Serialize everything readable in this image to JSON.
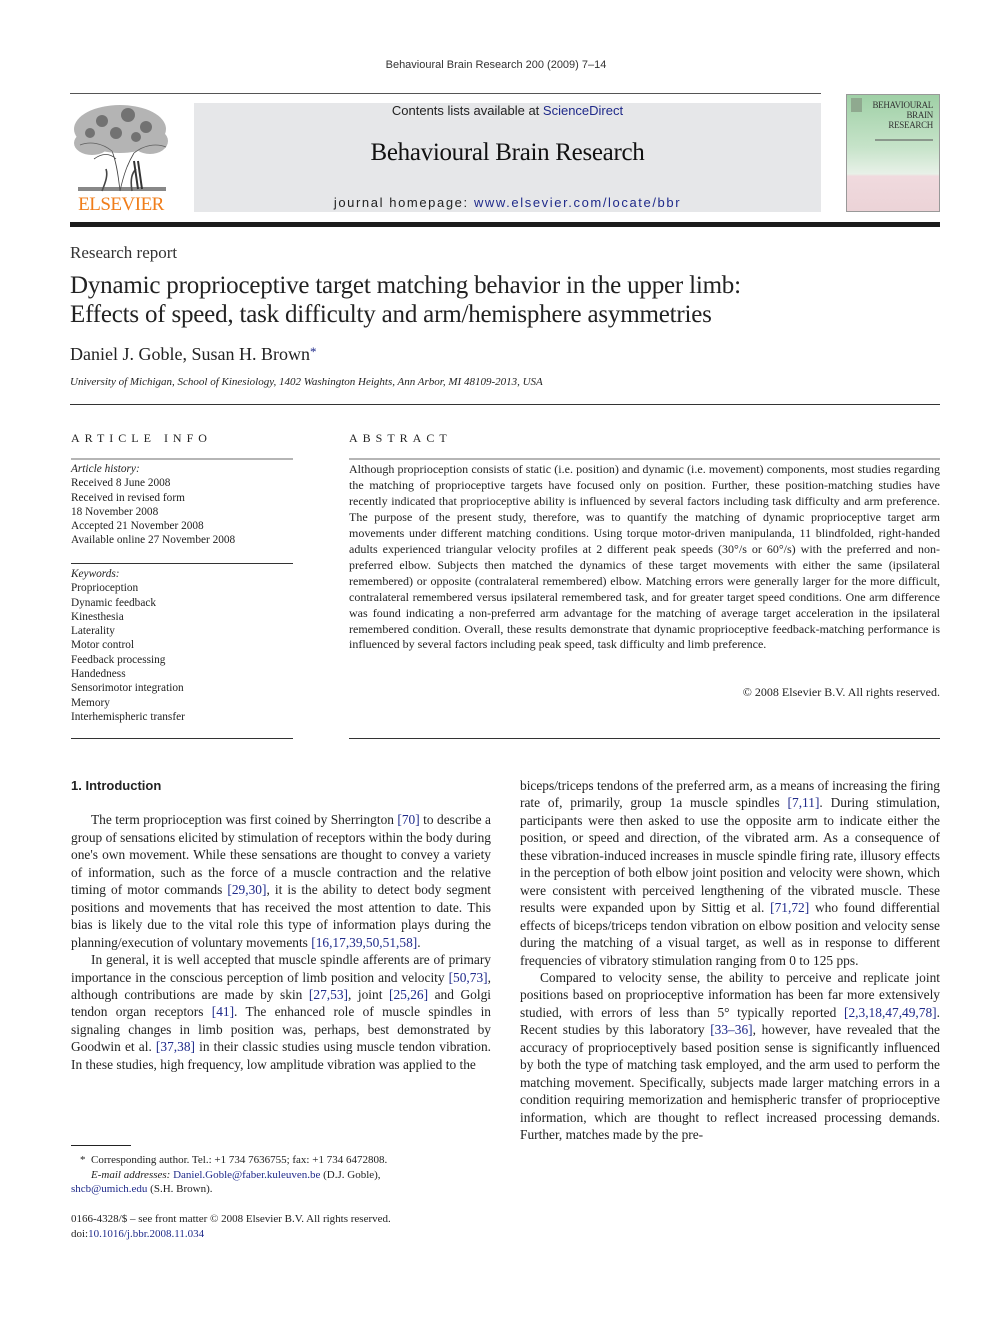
{
  "running_head": "Behavioural Brain Research 200 (2009) 7–14",
  "publisher": {
    "logo_word": "ELSEVIER",
    "brand_color": "#f07d1a"
  },
  "banner": {
    "contents_prefix": "Contents lists available at ",
    "contents_link": "ScienceDirect",
    "journal_title": "Behavioural Brain Research",
    "homepage_prefix": "journal homepage: ",
    "homepage_link": "www.elsevier.com/locate/bbr",
    "link_color": "#1f2a8a"
  },
  "cover": {
    "title_line1": "BEHAVIOURAL",
    "title_line2": "BRAIN",
    "title_line3": "RESEARCH"
  },
  "article": {
    "section_type": "Research report",
    "title_line1": "Dynamic proprioceptive target matching behavior in the upper limb:",
    "title_line2": "Effects of speed, task difficulty and arm/hemisphere asymmetries",
    "authors": "Daniel J. Goble, Susan H. Brown",
    "author_mark": "*",
    "affiliation": "University of Michigan, School of Kinesiology, 1402 Washington Heights, Ann Arbor, MI 48109-2013, USA"
  },
  "article_info": {
    "heading": "ARTICLE INFO",
    "history_label": "Article history:",
    "history": [
      "Received 8 June 2008",
      "Received in revised form",
      "18 November 2008",
      "Accepted 21 November 2008",
      "Available online 27 November 2008"
    ],
    "keywords_label": "Keywords:",
    "keywords": [
      "Proprioception",
      "Dynamic feedback",
      "Kinesthesia",
      "Laterality",
      "Motor control",
      "Feedback processing",
      "Handedness",
      "Sensorimotor integration",
      "Memory",
      "Interhemispheric transfer"
    ]
  },
  "abstract": {
    "heading": "ABSTRACT",
    "text": "Although proprioception consists of static (i.e. position) and dynamic (i.e. movement) components, most studies regarding the matching of proprioceptive targets have focused only on position. Further, these position-matching studies have recently indicated that proprioceptive ability is influenced by several factors including task difficulty and arm preference. The purpose of the present study, therefore, was to quantify the matching of dynamic proprioceptive target arm movements under different matching conditions. Using torque motor-driven manipulanda, 11 blindfolded, right-handed adults experienced tri­angular velocity profiles at 2 different peak speeds (30°/s or 60°/s) with the preferred and non-preferred elbow. Subjects then matched the dynamics of these target movements with either the same (ipsilateral remembered) or opposite (contralateral remembered) elbow. Matching errors were generally larger for the more difficult, contralateral remembered versus ipsilateral remembered task, and for greater tar­get speed conditions. One arm difference was found indicating a non-preferred arm advantage for the matching of average target acceleration in the ipsilateral remembered condition. Overall, these results demonstrate that dynamic proprioceptive feedback-matching performance is influenced by several fac­tors including peak speed, task difficulty and limb preference.",
    "copyright": "© 2008 Elsevier B.V. All rights reserved."
  },
  "body": {
    "section_heading": "1.  Introduction",
    "left_paragraphs": [
      [
        {
          "t": "The term proprioception was first coined by Sherrington "
        },
        {
          "t": "[70]",
          "ref": true
        },
        {
          "t": " to describe a group of sensations elicited by stimulation of receptors within the body during one's own movement. While these sensa­tions are thought to convey a variety of information, such as the force of a muscle contraction and the relative timing of motor com­mands "
        },
        {
          "t": "[29,30]",
          "ref": true
        },
        {
          "t": ", it is the ability to detect body segment positions and movements that has received the most attention to date. This bias is likely due to the vital role this type of information plays during the planning/execution of voluntary movements "
        },
        {
          "t": "[16,17,39,50,51,58]",
          "ref": true
        },
        {
          "t": "."
        }
      ],
      [
        {
          "t": "In general, it is well accepted that muscle spindle afferents are of primary importance in the conscious perception of limb posi­tion and velocity "
        },
        {
          "t": "[50,73]",
          "ref": true
        },
        {
          "t": ", although contributions are made by skin "
        },
        {
          "t": "[27,53]",
          "ref": true
        },
        {
          "t": ", joint "
        },
        {
          "t": "[25,26]",
          "ref": true
        },
        {
          "t": " and Golgi tendon organ receptors "
        },
        {
          "t": "[41]",
          "ref": true
        },
        {
          "t": ". The enhanced role of muscle spindles in signaling changes in limb posi­tion was, perhaps, best demonstrated by Goodwin et al. "
        },
        {
          "t": "[37,38]",
          "ref": true
        },
        {
          "t": " in their classic studies using muscle tendon vibration. In these stud­ies, high frequency, low amplitude vibration was applied to the"
        }
      ]
    ],
    "right_paragraphs": [
      [
        {
          "t": "biceps/triceps tendons of the preferred arm, as a means of increas­ing the firing rate of, primarily, group 1a muscle spindles "
        },
        {
          "t": "[7,11]",
          "ref": true
        },
        {
          "t": ". During stimulation, participants were then asked to use the oppo­site arm to indicate either the position, or speed and direction, of the vibrated arm. As a consequence of these vibration-induced increases in muscle spindle firing rate, illusory effects in the percep­tion of both elbow joint position and velocity were shown, which were consistent with perceived lengthening of the vibrated muscle. These results were expanded upon by Sittig et al. "
        },
        {
          "t": "[71,72]",
          "ref": true
        },
        {
          "t": " who found differential effects of biceps/triceps tendon vibration on elbow posi­tion and velocity sense during the matching of a visual target, as well as in response to different frequencies of vibratory stimulation ranging from 0 to 125 pps."
        }
      ],
      [
        {
          "t": "Compared to velocity sense, the ability to perceive and repli­cate joint positions based on proprioceptive information has been far more extensively studied, with errors of less than 5° typi­cally reported "
        },
        {
          "t": "[2,3,18,47,49,78]",
          "ref": true
        },
        {
          "t": ". Recent studies by this laboratory "
        },
        {
          "t": "[33–36]",
          "ref": true
        },
        {
          "t": ", however, have revealed that the accuracy of propriocep­tively based position sense is significantly influenced by both the type of matching task employed, and the arm used to perform the matching movement. Specifically, subjects made larger match­ing errors in a condition requiring memorization and hemispheric transfer of proprioceptive information, which are thought to reflect increased processing demands. Further, matches made by the pre-"
        }
      ]
    ]
  },
  "footnotes": {
    "star": "*",
    "corresponding": "Corresponding author. Tel.: +1 734 7636755; fax: +1 734 6472808.",
    "email_label": "E-mail addresses:",
    "email1": "Daniel.Goble@faber.kuleuven.be",
    "email1_owner": " (D.J. Goble),",
    "email2": "shcb@umich.edu",
    "email2_owner": " (S.H. Brown).",
    "front_matter": "0166-4328/$ – see front matter © 2008 Elsevier B.V. All rights reserved.",
    "doi_label": "doi:",
    "doi": "10.1016/j.bbr.2008.11.034"
  }
}
